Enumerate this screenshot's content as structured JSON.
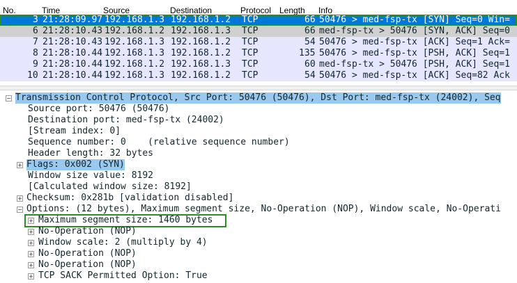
{
  "columns": [
    "No.",
    "Time",
    "Source",
    "Destination",
    "Protocol",
    "Length",
    "Info"
  ],
  "packets": [
    {
      "no": "3",
      "time": "21:28:09.97",
      "src": "192.168.1.3",
      "dst": "192.168.1.2",
      "proto": "TCP",
      "len": "66",
      "info": "50476 > med-fsp-tx [SYN] Seq=0 Win=",
      "style": "selected"
    },
    {
      "no": "6",
      "time": "21:28:10.43",
      "src": "192.168.1.2",
      "dst": "192.168.1.3",
      "proto": "TCP",
      "len": "66",
      "info": "med-fsp-tx > 50476 [SYN, ACK] Seq=0",
      "style": "gray"
    },
    {
      "no": "7",
      "time": "21:28:10.43",
      "src": "192.168.1.3",
      "dst": "192.168.1.2",
      "proto": "TCP",
      "len": "54",
      "info": "50476 > med-fsp-tx [ACK] Seq=1 Ack=",
      "style": "lavender"
    },
    {
      "no": "8",
      "time": "21:28:10.44",
      "src": "192.168.1.3",
      "dst": "192.168.1.2",
      "proto": "TCP",
      "len": "135",
      "info": "50476 > med-fsp-tx [PSH, ACK] Seq=1",
      "style": "lavender"
    },
    {
      "no": "9",
      "time": "21:28:10.44",
      "src": "192.168.1.2",
      "dst": "192.168.1.3",
      "proto": "TCP",
      "len": "60",
      "info": "med-fsp-tx > 50476 [PSH, ACK] Seq=1",
      "style": "lavender"
    },
    {
      "no": "10",
      "time": "21:28:10.44",
      "src": "192.168.1.3",
      "dst": "192.168.1.2",
      "proto": "TCP",
      "len": "54",
      "info": "50476 > med-fsp-tx [ACK] Seq=82 Ack",
      "style": "lavender"
    }
  ],
  "details": [
    {
      "text": "Transmission Control Protocol, Src Port: 50476 (50476), Dst Port: med-fsp-tx (24002), Seq",
      "toggle": "−",
      "highlight": true
    },
    {
      "text": "Source port: 50476 (50476)"
    },
    {
      "text": "Destination port: med-fsp-tx (24002)"
    },
    {
      "text": "[Stream index: 0]"
    },
    {
      "text": "Sequence number: 0    (relative sequence number)"
    },
    {
      "text": "Header length: 32 bytes"
    },
    {
      "text": "Flags: 0x002 (SYN)",
      "toggle": "+",
      "highlight": true
    },
    {
      "text": "Window size value: 8192"
    },
    {
      "text": "[Calculated window size: 8192]"
    },
    {
      "text": "Checksum: 0x281b [validation disabled]",
      "toggle": "+"
    },
    {
      "text": "Options: (12 bytes), Maximum segment size, No-Operation (NOP), Window scale, No-Operati",
      "toggle": "−"
    },
    {
      "text": "Maximum segment size: 1460 bytes",
      "toggle": "+"
    },
    {
      "text": "No-Operation (NOP)",
      "toggle": "+"
    },
    {
      "text": "Window scale: 2 (multiply by 4)",
      "toggle": "+"
    },
    {
      "text": "No-Operation (NOP)",
      "toggle": "+"
    },
    {
      "text": "No-Operation (NOP)",
      "toggle": "+"
    },
    {
      "text": "TCP SACK Permitted Option: True",
      "toggle": "+"
    }
  ]
}
